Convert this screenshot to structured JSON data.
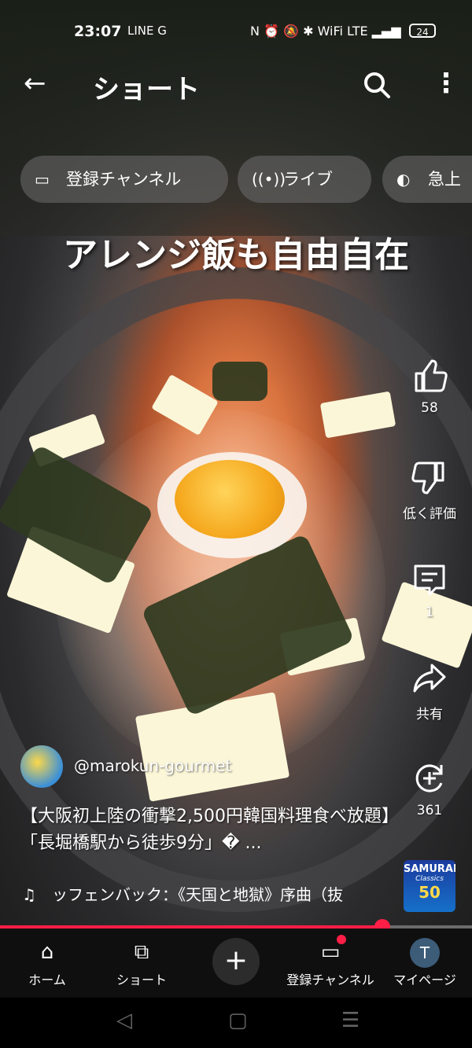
{
  "status": {
    "time": "23:07",
    "left_icons": "LINE G",
    "right_icons": "N ⏰ 🔕 ✱ WiFi LTE ▂▄▆",
    "battery": "24"
  },
  "header": {
    "title": "ショート"
  },
  "chips": [
    {
      "icon": "subscriptions-icon",
      "label": "登録チャンネル"
    },
    {
      "icon": "live-icon",
      "label": "ライブ"
    },
    {
      "icon": "trending-icon",
      "label": "急上"
    }
  ],
  "video": {
    "caption": "アレンジ飯も自由自在",
    "channel": "@marokun-gourmet",
    "title": "【大阪初上陸の衝撃2,500円韓国料理食べ放題】「長堀橋駅から徒歩9分」� ...",
    "music": "ッフェンバック：《天国と地獄》序曲（抜",
    "album": {
      "line1": "SAMURAI",
      "line2": "Classics",
      "line3": "50"
    },
    "progress_fraction": 0.81
  },
  "actions": {
    "like": "58",
    "dislike": "低く評価",
    "comments": "1",
    "share": "共有",
    "remix": "361"
  },
  "nav": {
    "home": "ホーム",
    "shorts": "ショート",
    "subscriptions": "登録チャンネル",
    "mypage": "マイページ",
    "avatar_letter": "T"
  }
}
